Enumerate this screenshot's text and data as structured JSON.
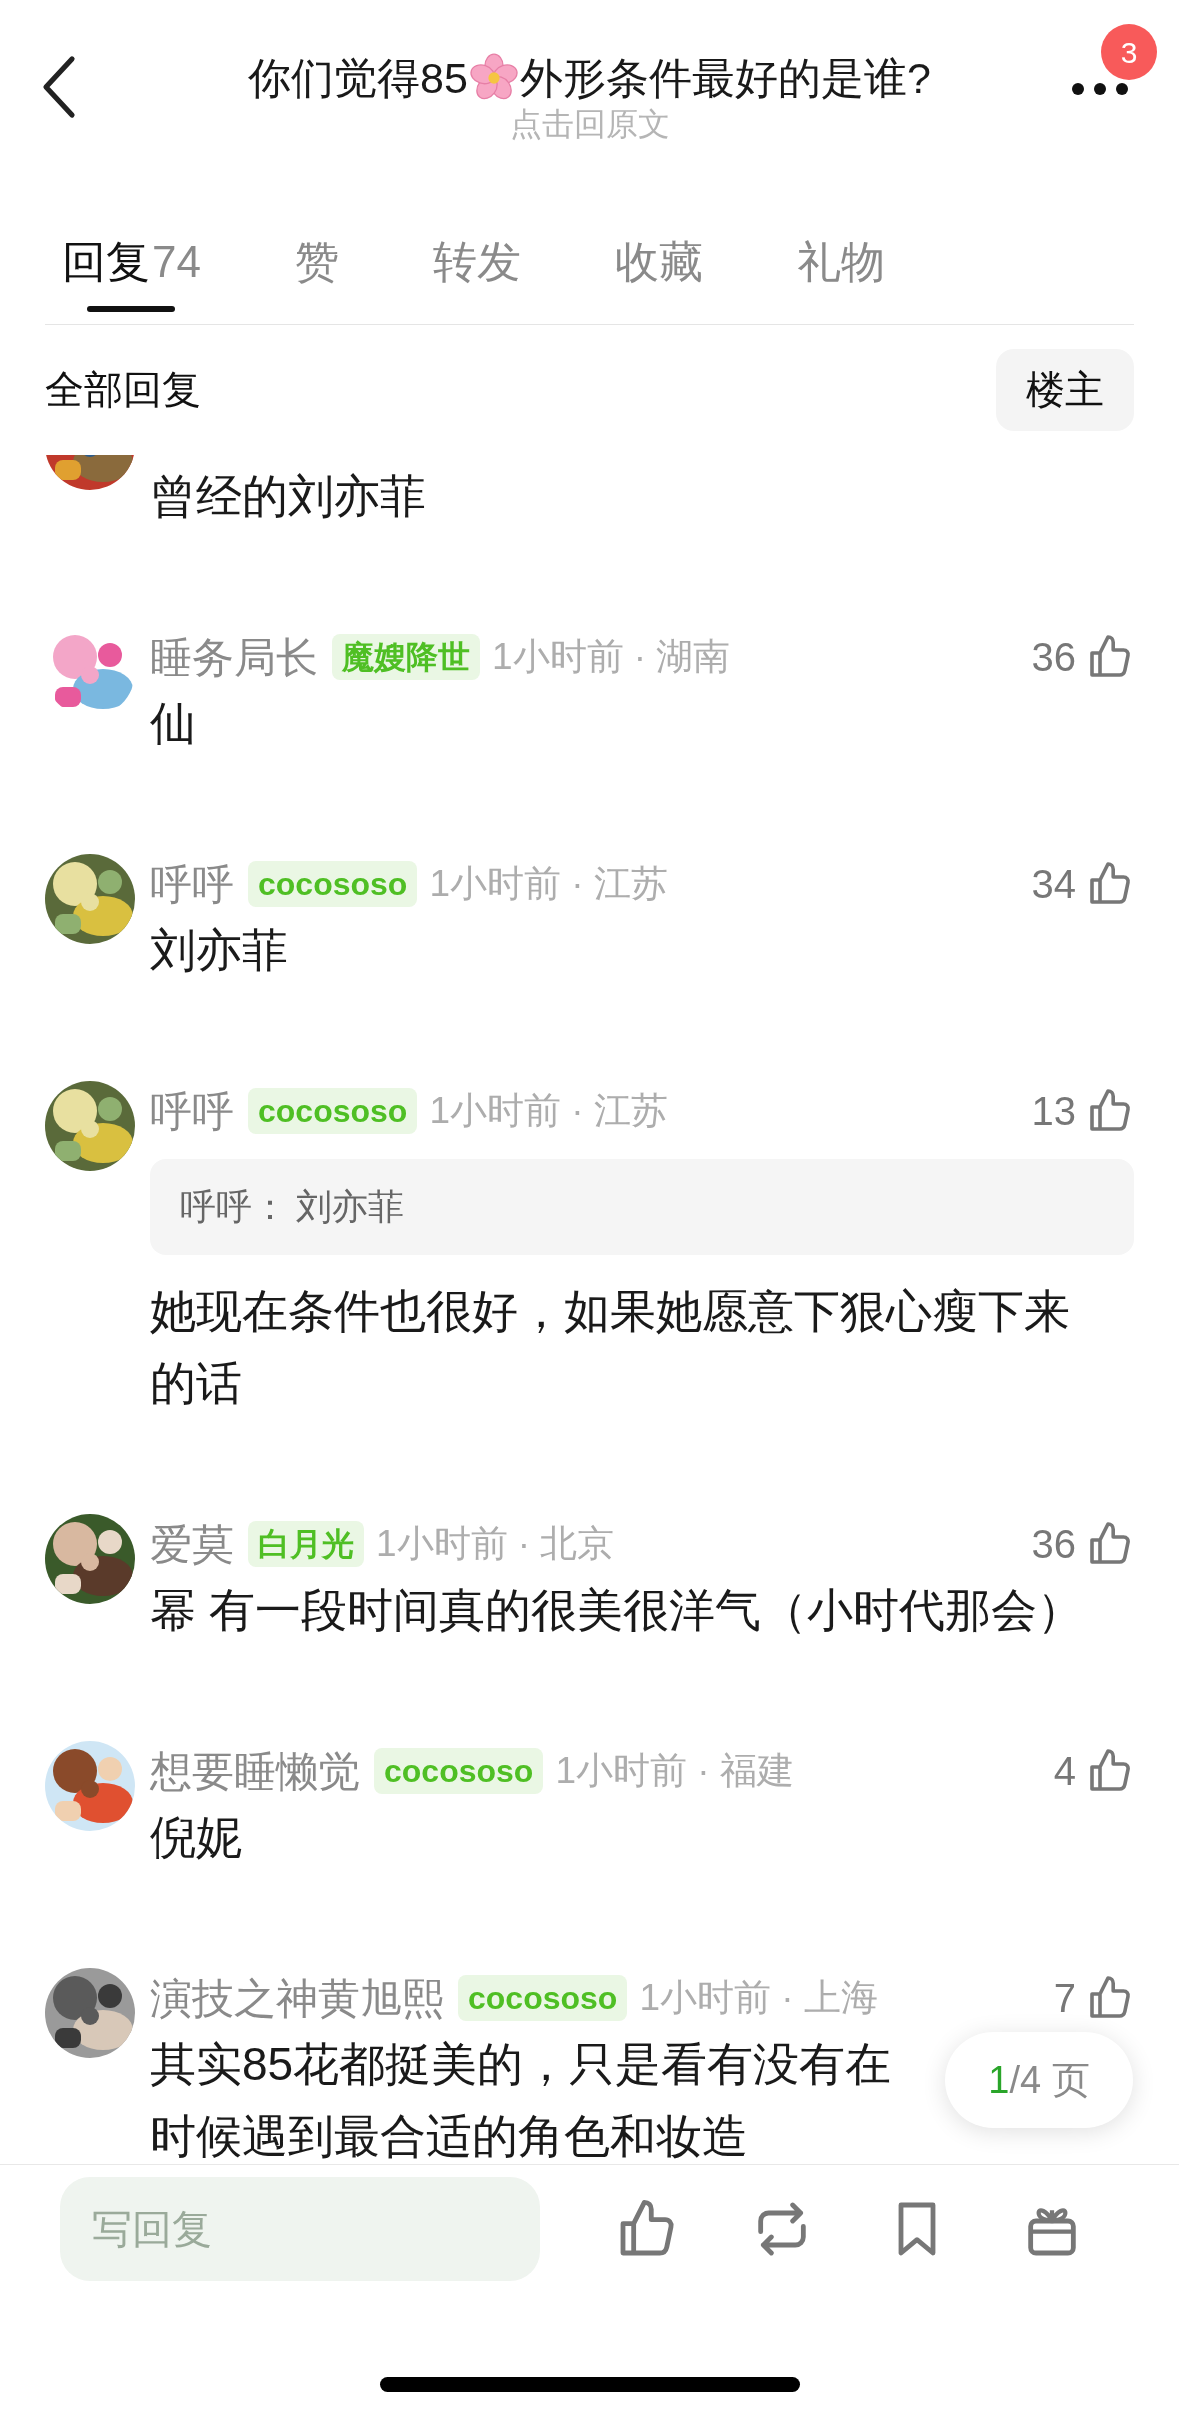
{
  "header": {
    "title_before": "你们觉得85",
    "title_after": "外形条件最好的是谁?",
    "subtitle": "点击回原文",
    "badge": "3"
  },
  "tabs": [
    {
      "label": "回复",
      "count": "74",
      "selected": true
    },
    {
      "label": "赞",
      "selected": false
    },
    {
      "label": "转发",
      "selected": false
    },
    {
      "label": "收藏",
      "selected": false
    },
    {
      "label": "礼物",
      "selected": false
    }
  ],
  "filter": {
    "label": "全部回复",
    "button": "楼主"
  },
  "comments": [
    {
      "body": [
        "曾经的刘亦菲"
      ]
    },
    {
      "name": "睡务局长",
      "tag": "魔嫂降世",
      "meta": "1小时前 · 湖南",
      "likes": "36",
      "body": [
        "仙"
      ]
    },
    {
      "name": "呼呼",
      "tag": "cocososo",
      "meta": "1小时前 · 江苏",
      "likes": "34",
      "body": [
        "刘亦菲"
      ]
    },
    {
      "name": "呼呼",
      "tag": "cocososo",
      "meta": "1小时前 · 江苏",
      "likes": "13",
      "quote": {
        "author": "呼呼：",
        "text": "刘亦菲"
      },
      "body": [
        "她现在条件也很好，如果她愿意下狠心瘦下来",
        "的话"
      ]
    },
    {
      "name": "爱莫",
      "tag": "白月光",
      "meta": "1小时前 · 北京",
      "likes": "36",
      "body": [
        "幂 有一段时间真的很美很洋气（小时代那会）"
      ]
    },
    {
      "name": "想要睡懒觉",
      "tag": "cocososo",
      "meta": "1小时前 · 福建",
      "likes": "4",
      "body": [
        "倪妮"
      ]
    },
    {
      "name": "演技之神黄旭熙",
      "tag": "cocososo",
      "meta": "1小时前 · 上海",
      "likes": "7",
      "body": [
        "其实85花都挺美的，只是看有没有在",
        "时候遇到最合适的角色和妆造"
      ]
    }
  ],
  "page_indicator": {
    "current": "1",
    "total": "/4 页"
  },
  "reply_bar": {
    "placeholder": "写回复"
  }
}
